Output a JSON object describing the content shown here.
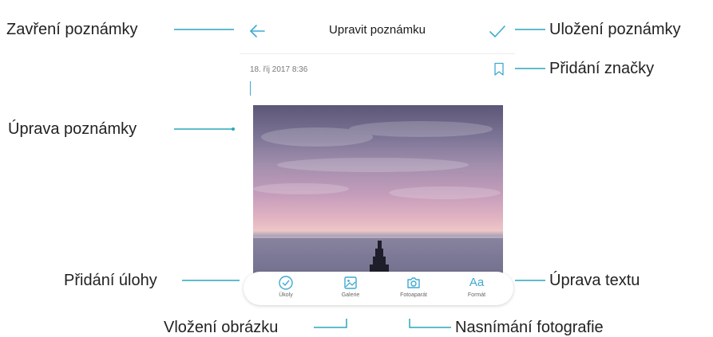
{
  "header": {
    "title": "Upravit poznámku"
  },
  "note": {
    "date": "18. říj 2017 8:36"
  },
  "toolbar": {
    "items": [
      {
        "label": "Úkoly",
        "icon": "check-circle-icon"
      },
      {
        "label": "Galerie",
        "icon": "gallery-icon"
      },
      {
        "label": "Fotoaparát",
        "icon": "camera-icon"
      },
      {
        "label": "Formát",
        "icon": "format-text-icon"
      }
    ],
    "format_glyph": "Aa"
  },
  "callouts": {
    "close_note": "Zavření poznámky",
    "save_note": "Uložení poznámky",
    "add_bookmark": "Přidání značky",
    "edit_note": "Úprava poznámky",
    "add_task": "Přidání úlohy",
    "edit_text": "Úprava textu",
    "insert_image": "Vložení obrázku",
    "take_photo": "Nasnímání fotografie"
  },
  "colors": {
    "accent": "#3fa9d0",
    "leader": "#2aa7b8"
  }
}
